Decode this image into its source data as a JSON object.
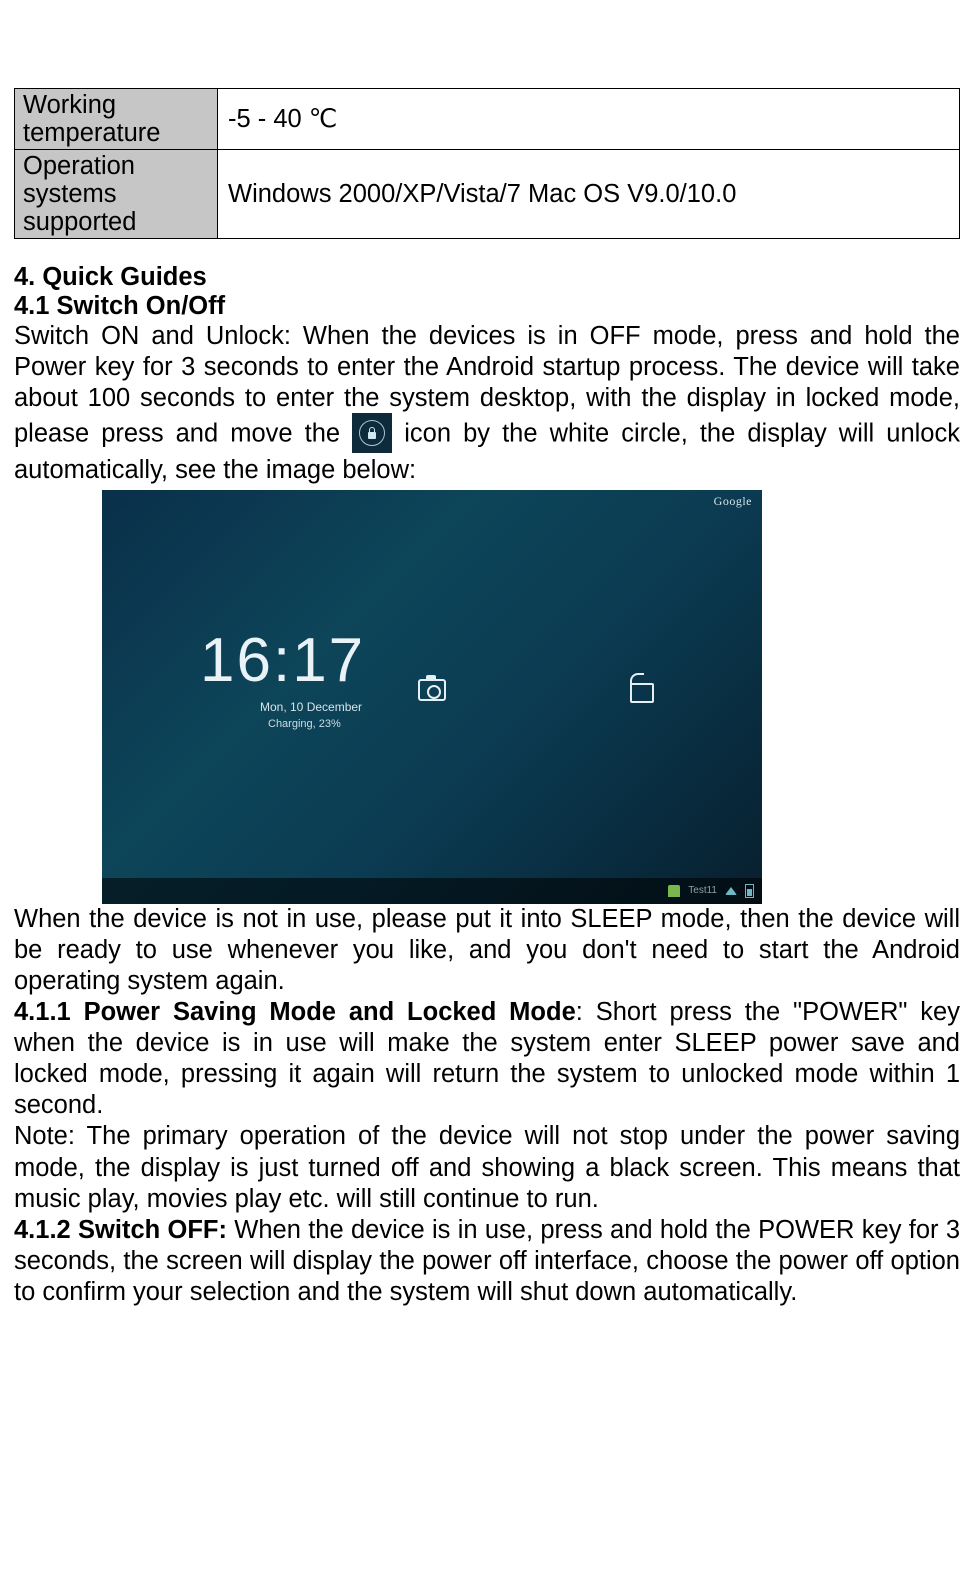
{
  "table": {
    "rows": [
      {
        "label": "Working temperature",
        "value": "-5 - 40 ℃"
      },
      {
        "label": "Operation systems supported",
        "value": "Windows 2000/XP/Vista/7 Mac OS V9.0/10.0"
      }
    ]
  },
  "section4": {
    "title": "4. Quick Guides",
    "s41_title": "4.1 Switch On/Off",
    "s41_p1_a": "Switch ON and Unlock: When the devices is in OFF mode, press and hold the Power key for 3 seconds to enter the Android startup process. The device will take about 100 seconds to enter the system desktop, with the display in locked mode, please press and move the ",
    "s41_p1_b": " icon by the white circle, the display will unlock automatically, see the image below:",
    "s41_p2": "When the device is not in use, please put it into SLEEP mode, then the device will be ready to use whenever you like, and you don't need to start the Android operating system again.",
    "s411_label": "4.1.1 Power Saving Mode and Locked Mode",
    "s411_body": ": Short press the \"POWER\" key when the device is in use will make the system enter SLEEP power save and locked mode, pressing it again will return the system to unlocked mode within 1 second.",
    "s411_note": "Note: The primary operation of the device will not stop under the power saving mode, the display is just turned off and showing a black screen. This means that music play, movies play etc. will still continue to run.",
    "s412_label": "4.1.2 Switch OFF:",
    "s412_body": " When the device is in use, press and hold the POWER key for 3 seconds, the screen will display the power off interface, choose the power off option to confirm your selection and the system will shut down automatically."
  },
  "lockscreen": {
    "google": "Google",
    "time": "16:17",
    "date": "Mon, 10 December",
    "charging": "Charging, 23%",
    "nav_text": "Test11"
  }
}
